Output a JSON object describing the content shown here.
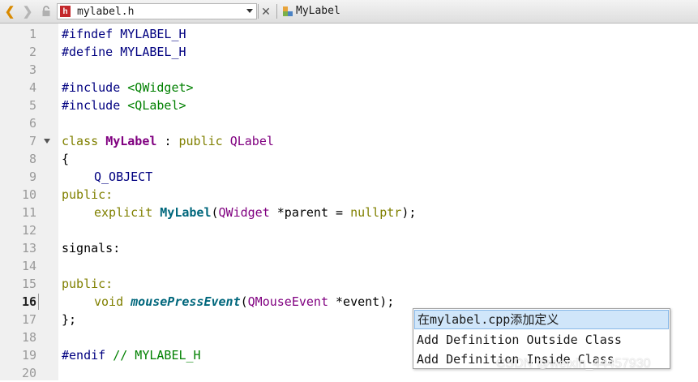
{
  "toolbar": {
    "back_icon": "chevron-left-icon",
    "forward_icon": "chevron-right-icon",
    "lock_icon": "lock-icon",
    "file_type_badge": "h",
    "file_name": "mylabel.h",
    "close_glyph": "✕",
    "symbol_name": "MyLabel",
    "colors": {
      "back": "#d98a00",
      "badge": "#c3272b"
    }
  },
  "editor": {
    "current_line": 16,
    "line_numbers": [
      "1",
      "2",
      "3",
      "4",
      "5",
      "6",
      "7",
      "8",
      "9",
      "10",
      "11",
      "12",
      "13",
      "14",
      "15",
      "16",
      "17",
      "18",
      "19",
      "20"
    ],
    "lines": {
      "l1_dir": "#ifndef",
      "l1_name": "MYLABEL_H",
      "l2_dir": "#define",
      "l2_name": "MYLABEL_H",
      "l4_dir": "#include",
      "l4_hdr": "<QWidget>",
      "l5_dir": "#include",
      "l5_hdr": "<QLabel>",
      "l7_class": "class",
      "l7_name": "MyLabel",
      "l7_colon": ":",
      "l7_public": "public",
      "l7_base": "QLabel",
      "l8": "{",
      "l9": "Q_OBJECT",
      "l10": "public:",
      "l11_explicit": "explicit",
      "l11_ctor": "MyLabel",
      "l11_open": "(",
      "l11_type": "QWidget",
      "l11_param": "*parent =",
      "l11_null": "nullptr",
      "l11_close": ");",
      "l13": "signals:",
      "l15": "public:",
      "l16_void": "void",
      "l16_fn": "mousePressEvent",
      "l16_open": "(",
      "l16_type": "QMouseEvent",
      "l16_param": "*event);",
      "l17": "};",
      "l19_dir": "#endif",
      "l19_cmt": "// MYLABEL_H"
    }
  },
  "popup": {
    "items": [
      "在mylabel.cpp添加定义",
      "Add Definition Outside Class",
      "Add Definition Inside Class"
    ],
    "selected_index": 0
  },
  "watermark": "CSDN @weixin_44457930"
}
